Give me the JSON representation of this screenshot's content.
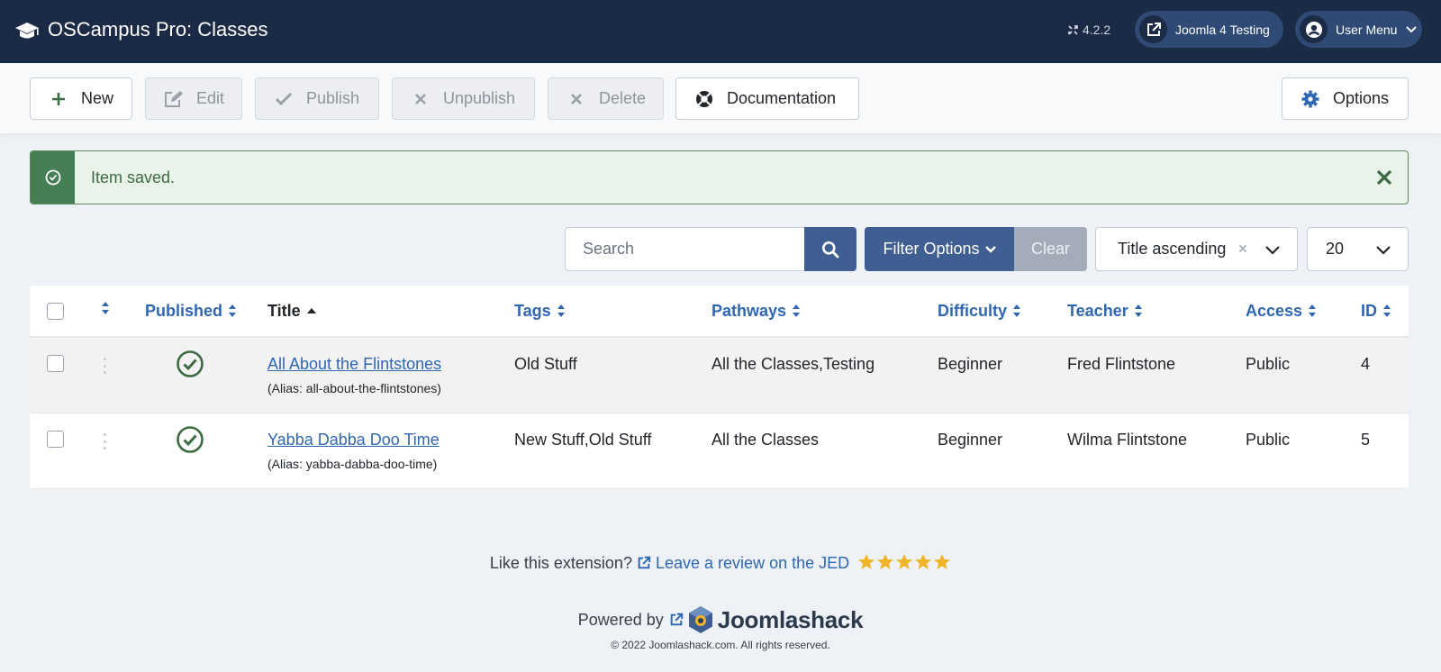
{
  "header": {
    "app_title": "OSCampus Pro: Classes",
    "version": "4.2.2",
    "site_link_label": "Joomla 4 Testing",
    "user_menu_label": "User Menu"
  },
  "toolbar": {
    "new_label": "New",
    "edit_label": "Edit",
    "publish_label": "Publish",
    "unpublish_label": "Unpublish",
    "delete_label": "Delete",
    "documentation_label": "Documentation",
    "options_label": "Options"
  },
  "alert": {
    "message": "Item saved."
  },
  "filters": {
    "search_placeholder": "Search",
    "filter_options_label": "Filter Options",
    "clear_label": "Clear",
    "sort_value": "Title ascending",
    "limit_value": "20"
  },
  "table": {
    "columns": {
      "published": "Published",
      "title": "Title",
      "tags": "Tags",
      "pathways": "Pathways",
      "difficulty": "Difficulty",
      "teacher": "Teacher",
      "access": "Access",
      "id": "ID"
    },
    "rows": [
      {
        "title": "All About the Flintstones",
        "alias": "(Alias: all-about-the-flintstones)",
        "tags": "Old Stuff",
        "pathways": "All the Classes,Testing",
        "difficulty": "Beginner",
        "teacher": "Fred Flintstone",
        "access": "Public",
        "id": "4"
      },
      {
        "title": "Yabba Dabba Doo Time",
        "alias": "(Alias: yabba-dabba-doo-time)",
        "tags": "New Stuff,Old Stuff",
        "pathways": "All the Classes",
        "difficulty": "Beginner",
        "teacher": "Wilma Flintstone",
        "access": "Public",
        "id": "5"
      }
    ]
  },
  "footer": {
    "like_text": "Like this extension?",
    "review_link": "Leave a review on the JED",
    "powered_by": "Powered by",
    "brand": "Joomlashack",
    "copyright": "© 2022 Joomlashack.com. All rights reserved."
  },
  "colors": {
    "header_bg": "#1c2b45",
    "accent": "#3f5e91",
    "link": "#2f67b2",
    "success": "#457d54",
    "star": "#f0b429"
  }
}
